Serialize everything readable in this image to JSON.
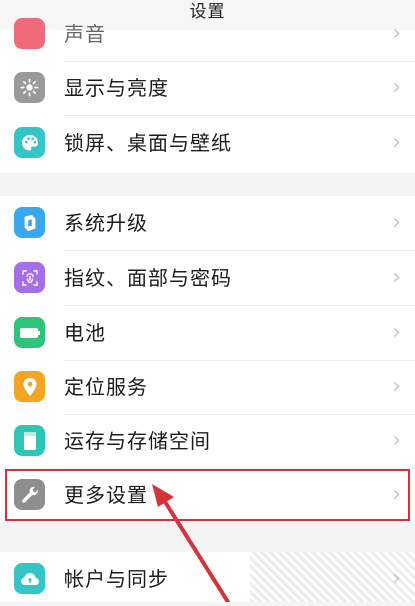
{
  "header": {
    "title": "设置"
  },
  "group1": [
    {
      "label": "声音",
      "icon": "sound-icon",
      "color": "#f06a7a"
    },
    {
      "label": "显示与亮度",
      "icon": "brightness-icon",
      "color": "#9a9a9a"
    },
    {
      "label": "锁屏、桌面与壁纸",
      "icon": "palette-icon",
      "color": "#34c6c6"
    }
  ],
  "group2": [
    {
      "label": "系统升级",
      "icon": "system-update-icon",
      "color": "#3aa8f0"
    },
    {
      "label": "指纹、面部与密码",
      "icon": "fingerprint-icon",
      "color": "#a46ee8"
    },
    {
      "label": "电池",
      "icon": "battery-icon",
      "color": "#2fc47a"
    },
    {
      "label": "定位服务",
      "icon": "location-icon",
      "color": "#f4a623"
    },
    {
      "label": "运存与存储空间",
      "icon": "storage-icon",
      "color": "#2ec4b6"
    },
    {
      "label": "更多设置",
      "icon": "wrench-icon",
      "color": "#8e8e8e"
    }
  ],
  "group3": [
    {
      "label": "帐户与同步",
      "icon": "cloud-sync-icon",
      "color": "#34c6c6"
    }
  ],
  "colors": {
    "highlight": "#d2343a",
    "arrow": "#d2343a"
  }
}
